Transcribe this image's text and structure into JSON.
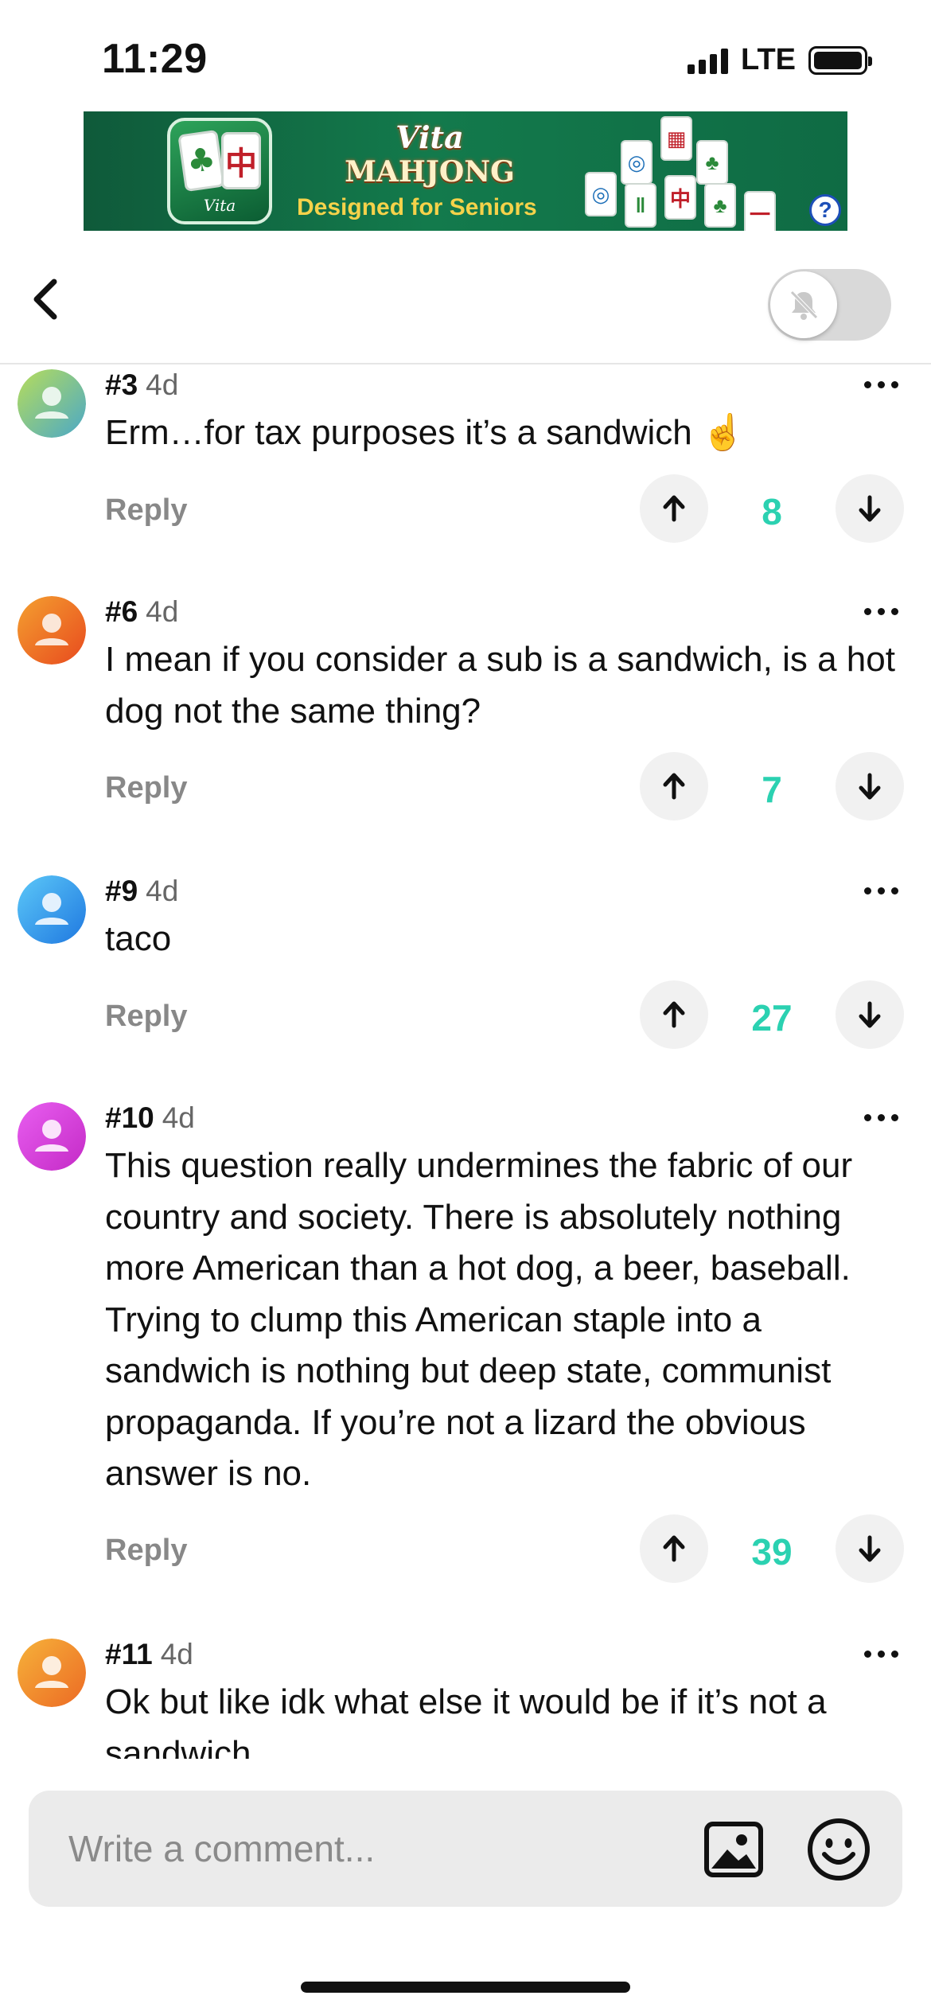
{
  "status_bar": {
    "time": "11:29",
    "network": "LTE"
  },
  "ad": {
    "brand": "Vita",
    "title_line1": "Vita",
    "title_line2": "MAHJONG",
    "subtitle": "Designed for Seniors",
    "help_glyph": "?"
  },
  "header": {
    "back_icon": "chevron-left-icon",
    "notification_toggle": {
      "state": "off",
      "icon": "bell-slash-icon"
    }
  },
  "comments": [
    {
      "number": "#3",
      "age": "4d",
      "text": "Erm…for tax purposes it’s a sandwich ☝️",
      "reply": "Reply",
      "votes": "8",
      "avatar_color": "#9ad06a"
    },
    {
      "number": "#6",
      "age": "4d",
      "text": "I mean if you consider a sub is a sandwich, is a hot dog not the same thing?",
      "reply": "Reply",
      "votes": "7",
      "avatar_color": "#f07030"
    },
    {
      "number": "#9",
      "age": "4d",
      "text": "taco",
      "reply": "Reply",
      "votes": "27",
      "avatar_color": "#3aa6f0"
    },
    {
      "number": "#10",
      "age": "4d",
      "text": "This question really undermines the fabric of our country and society. There is absolutely nothing more American than a hot dog, a beer, baseball. Trying to clump this American staple into a sandwich is nothing but deep state, communist propaganda. If you’re not a lizard the obvious answer is no.",
      "reply": "Reply",
      "votes": "39",
      "avatar_color": "#d63fd6"
    },
    {
      "number": "#11",
      "age": "4d",
      "text": "Ok but like idk what else it would be if it’s not a sandwich",
      "reply": "Reply",
      "votes": "",
      "avatar_color": "#f08a30"
    }
  ],
  "composer": {
    "placeholder": "Write a comment...",
    "image_icon": "image-icon",
    "emoji_icon": "smiley-icon"
  },
  "colors": {
    "vote_count": "#2bd1b1",
    "reply": "#888888"
  }
}
